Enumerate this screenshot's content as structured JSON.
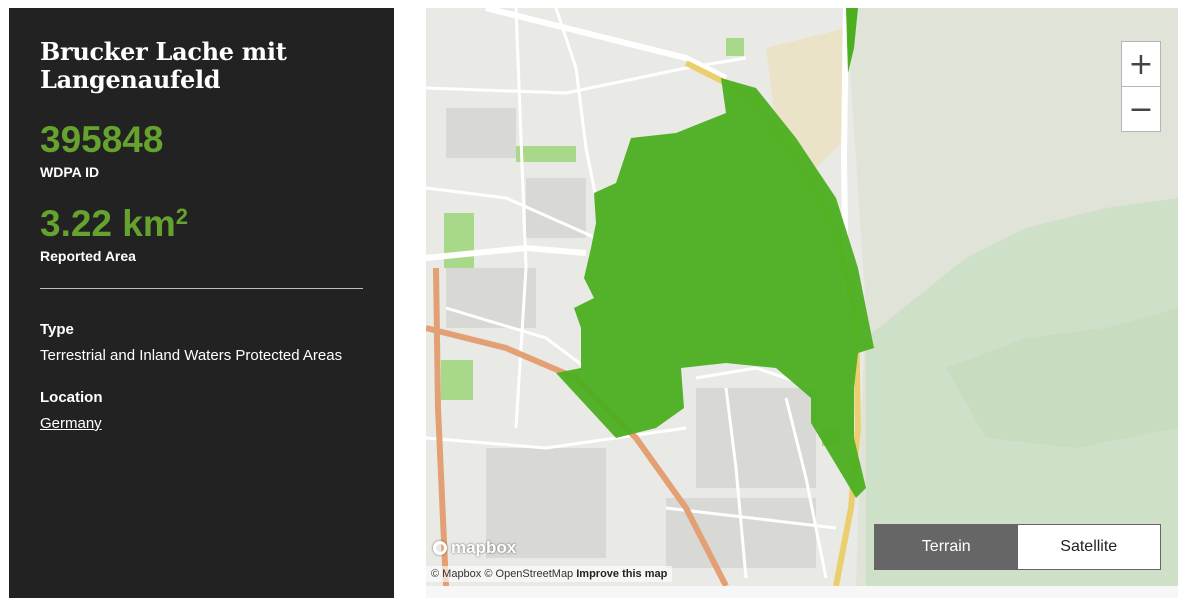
{
  "site": {
    "name": "Brucker Lache mit Langenaufeld",
    "wdpa_id": "395848",
    "wdpa_id_label": "WDPA ID",
    "area_value": "3.22 km",
    "area_superscript": "2",
    "area_label": "Reported Area",
    "type_label": "Type",
    "type_value": "Terrestrial and Inland Waters Protected Areas",
    "location_label": "Location",
    "location_value": "Germany"
  },
  "map": {
    "zoom_in": "+",
    "zoom_out": "−",
    "toggle": {
      "terrain": "Terrain",
      "satellite": "Satellite",
      "active": "terrain"
    },
    "logo": "mapbox",
    "attribution": {
      "mapbox": "© Mapbox",
      "osm": "© OpenStreetMap",
      "improve": "Improve this map"
    },
    "colors": {
      "protected_area": "#4caf20",
      "forest": "#c9dcc0",
      "highway": "#e2a074",
      "road": "#ffffff",
      "park": "#a8d88a"
    }
  },
  "colors": {
    "panel_bg": "#222222",
    "accent": "#65a22e"
  }
}
